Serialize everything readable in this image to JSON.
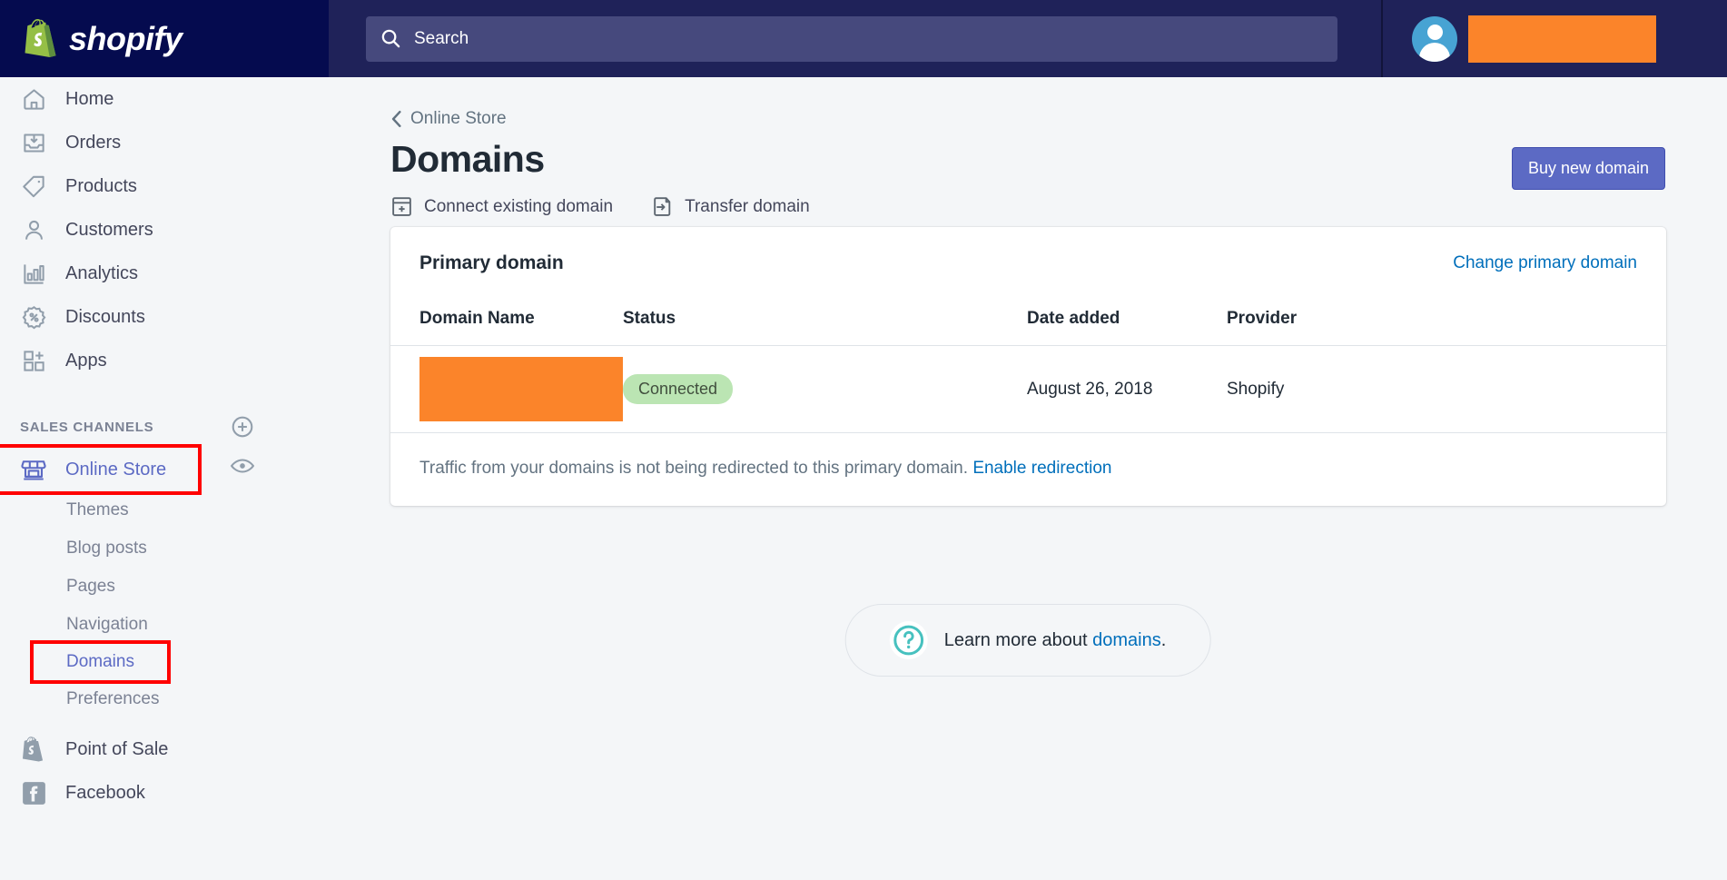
{
  "topbar": {
    "brand_name": "shopify",
    "search": {
      "placeholder": "Search",
      "value": ""
    },
    "redacted_user_label": ""
  },
  "sidebar": {
    "primary_items": [
      {
        "label": "Home",
        "icon": "home-icon"
      },
      {
        "label": "Orders",
        "icon": "orders-inbox-icon"
      },
      {
        "label": "Products",
        "icon": "product-tag-icon"
      },
      {
        "label": "Customers",
        "icon": "customer-person-icon"
      },
      {
        "label": "Analytics",
        "icon": "analytics-bar-chart-icon"
      },
      {
        "label": "Discounts",
        "icon": "discount-percent-icon"
      },
      {
        "label": "Apps",
        "icon": "apps-grid-plus-icon"
      }
    ],
    "section": {
      "title": "SALES CHANNELS",
      "add_icon": "circled-plus-icon",
      "view_icon": "eye-icon"
    },
    "channel": {
      "label": "Online Store",
      "icon": "storefront-icon"
    },
    "sub_items": [
      {
        "label": "Themes"
      },
      {
        "label": "Blog posts"
      },
      {
        "label": "Pages"
      },
      {
        "label": "Navigation"
      },
      {
        "label": "Domains"
      },
      {
        "label": "Preferences"
      }
    ],
    "bottom_items": [
      {
        "label": "Point of Sale",
        "icon": "shopify-bag-icon"
      },
      {
        "label": "Facebook",
        "icon": "facebook-icon"
      }
    ]
  },
  "main": {
    "breadcrumb": {
      "label": "Online Store",
      "icon": "chevron-left-icon"
    },
    "page_title": "Domains",
    "actions": [
      {
        "label": "Connect existing domain",
        "icon": "connect-domain-icon"
      },
      {
        "label": "Transfer domain",
        "icon": "transfer-domain-icon"
      }
    ],
    "buy_button": "Buy new domain",
    "card": {
      "title": "Primary domain",
      "change_link": "Change primary domain",
      "columns": [
        "Domain Name",
        "Status",
        "Date added",
        "Provider"
      ],
      "rows": [
        {
          "domain_name": "",
          "status": "Connected",
          "date_added": "August 26, 2018",
          "provider": "Shopify"
        }
      ],
      "footer_text": "Traffic from your domains is not being redirected to this primary domain.",
      "footer_link": "Enable redirection"
    },
    "help": {
      "icon": "question-mark-icon",
      "text": "Learn more about ",
      "link": "domains",
      "suffix": "."
    }
  },
  "colors": {
    "brand_navy": "#050b4f",
    "topbar_navy": "#1f2259",
    "accent_indigo": "#5c6ac4",
    "link_blue": "#006fbb",
    "badge_green": "#bbe5b3",
    "redaction_orange": "#fb842a",
    "annotation_red": "#ff0000",
    "help_teal": "#47c1bf"
  }
}
